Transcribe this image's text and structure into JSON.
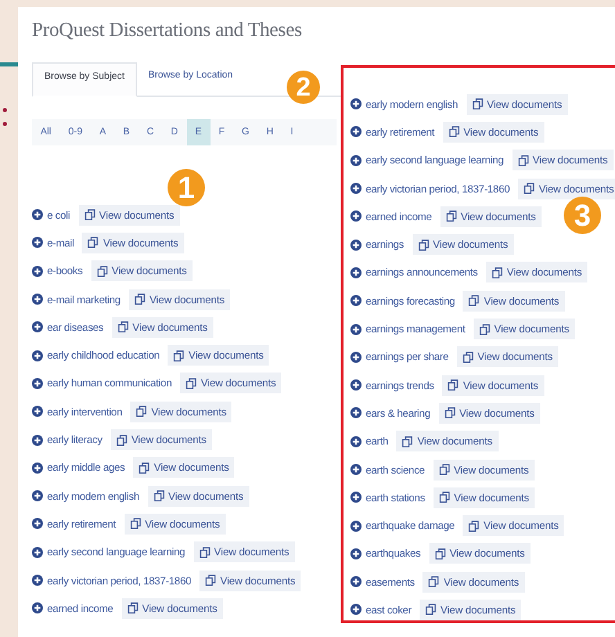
{
  "page_title": "ProQuest Dissertations and Theses",
  "tabs": [
    {
      "label": "Browse by Subject",
      "selected": true
    },
    {
      "label": "Browse by Location",
      "selected": false
    }
  ],
  "letters": [
    {
      "label": "All",
      "selected": false
    },
    {
      "label": "0-9",
      "selected": false
    },
    {
      "label": "A",
      "selected": false
    },
    {
      "label": "B",
      "selected": false
    },
    {
      "label": "C",
      "selected": false
    },
    {
      "label": "D",
      "selected": false
    },
    {
      "label": "E",
      "selected": true
    },
    {
      "label": "F",
      "selected": false
    },
    {
      "label": "G",
      "selected": false
    },
    {
      "label": "H",
      "selected": false
    },
    {
      "label": "I",
      "selected": false
    }
  ],
  "callouts": [
    "1",
    "2",
    "3"
  ],
  "subjects": [
    {
      "label": "e coli",
      "link": "View documents"
    },
    {
      "label": "e-mail",
      "link": "View documents"
    },
    {
      "label": "e-books",
      "link": "View documents"
    },
    {
      "label": "e-mail marketing",
      "link": "View documents"
    },
    {
      "label": "ear diseases",
      "link": "View documents"
    },
    {
      "label": "early childhood education",
      "link": "View documents"
    },
    {
      "label": "early human communication",
      "link": "View documents"
    },
    {
      "label": "early intervention",
      "link": "View documents"
    },
    {
      "label": "early literacy",
      "link": "View documents"
    },
    {
      "label": "early middle ages",
      "link": "View documents"
    },
    {
      "label": "early modern english",
      "link": "View documents"
    },
    {
      "label": "early retirement",
      "link": "View documents"
    },
    {
      "label": "early second language learning",
      "link": "View documents"
    },
    {
      "label": "early victorian period, 1837-1860",
      "link": "View documents"
    },
    {
      "label": "earned income",
      "link": "View documents"
    }
  ],
  "highlighted_subjects": [
    {
      "label": "early modern english",
      "link": "View documents"
    },
    {
      "label": "early retirement",
      "link": "View documents"
    },
    {
      "label": "early second language learning",
      "link": "View documents"
    },
    {
      "label": "early victorian period, 1837-1860",
      "link": "View documents"
    },
    {
      "label": "earned income",
      "link": "View documents"
    },
    {
      "label": "earnings",
      "link": "View documents"
    },
    {
      "label": "earnings announcements",
      "link": "View documents"
    },
    {
      "label": "earnings forecasting",
      "link": "View documents"
    },
    {
      "label": "earnings management",
      "link": "View documents"
    },
    {
      "label": "earnings per share",
      "link": "View documents"
    },
    {
      "label": "earnings trends",
      "link": "View documents"
    },
    {
      "label": "ears & hearing",
      "link": "View documents"
    },
    {
      "label": "earth",
      "link": "View documents"
    },
    {
      "label": "earth science",
      "link": "View documents"
    },
    {
      "label": "earth stations",
      "link": "View documents"
    },
    {
      "label": "earthquake damage",
      "link": "View documents"
    },
    {
      "label": "earthquakes",
      "link": "View documents"
    },
    {
      "label": "easements",
      "link": "View documents"
    },
    {
      "label": "east coker",
      "link": "View documents"
    }
  ]
}
